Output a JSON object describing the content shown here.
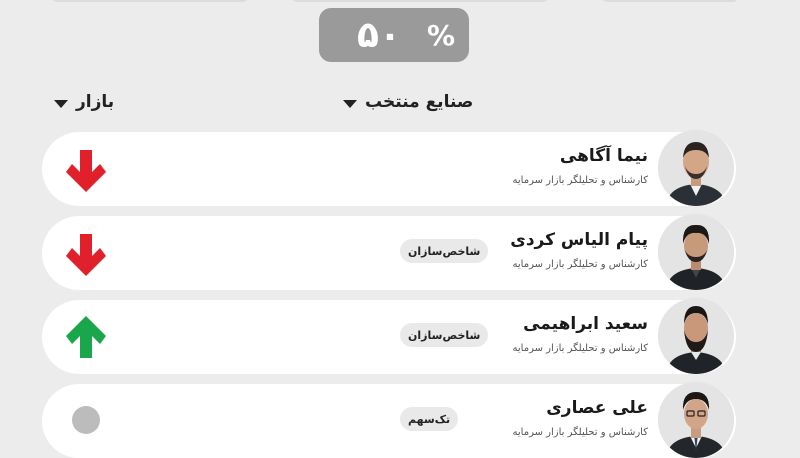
{
  "percent_badge": {
    "value": "۵۰",
    "symbol": "%"
  },
  "filters": {
    "market": {
      "label": "بازار"
    },
    "industry": {
      "label": "صنایع منتخب"
    }
  },
  "colors": {
    "down": "#e0202a",
    "up": "#1aa64a",
    "neutral": "#bcbcbc"
  },
  "analysts": [
    {
      "name": "نیما آگاهی",
      "role": "کارشناس و تحلیلگر بازار سرمایه",
      "tag": "",
      "signal": "down"
    },
    {
      "name": "پیام الیاس کردی",
      "role": "کارشناس و تحلیلگر بازار سرمایه",
      "tag": "شاخص‌سازان",
      "signal": "down"
    },
    {
      "name": "سعید ابراهیمی",
      "role": "کارشناس و تحلیلگر بازار سرمایه",
      "tag": "شاخص‌سازان",
      "signal": "up"
    },
    {
      "name": "علی عصاری",
      "role": "کارشناس و تحلیلگر بازار سرمایه",
      "tag": "تک‌سهم",
      "signal": "neutral"
    }
  ]
}
